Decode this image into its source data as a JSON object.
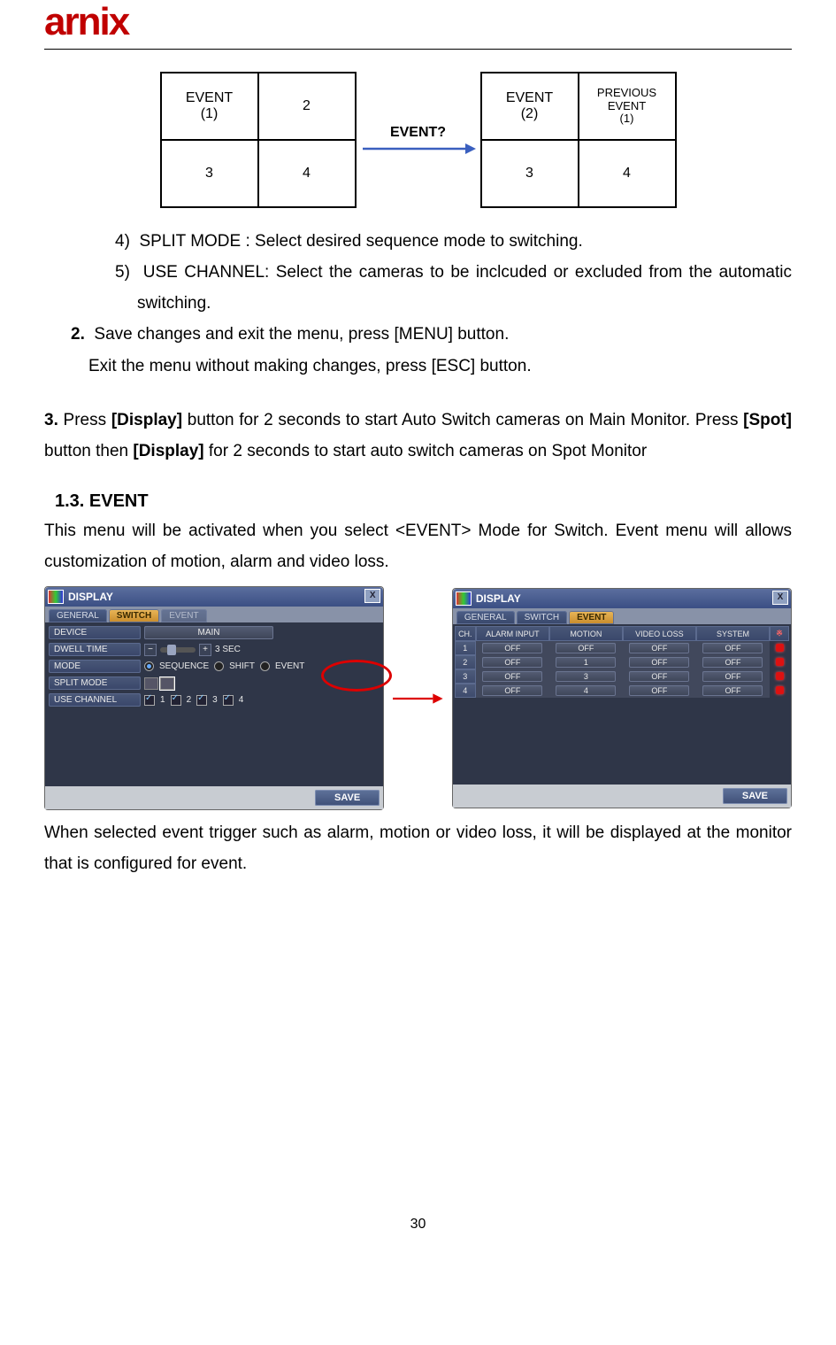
{
  "logo_text": "arnix",
  "diagram": {
    "left": [
      "EVENT\n(1)",
      "2",
      "3",
      "4"
    ],
    "right": [
      "EVENT\n(2)",
      "PREVIOUS\nEVENT\n(1)",
      "3",
      "4"
    ],
    "arrow_label": "EVENT?"
  },
  "list_items": {
    "i4_num": "4)",
    "i4": "SPLIT MODE : Select desired sequence mode to switching.",
    "i5_num": "5)",
    "i5": "USE CHANNEL: Select the cameras to be inclcuded or excluded from the automatic switching.",
    "s2_num": "2.",
    "s2a": "Save changes and exit the menu, press [MENU] button.",
    "s2b": "Exit the menu without making changes, press [ESC] button.",
    "s3": "3. Press [Display] button for 2 seconds to start Auto Switch cameras on Main Monitor. Press [Spot] button then [Display] for 2 seconds to start auto switch cameras on Spot Monitor"
  },
  "section_head": "1.3.  EVENT",
  "intro": "This menu will be activated when you select <EVENT> Mode for Switch. Event menu will allows customization of motion, alarm and video loss.",
  "outro": " When selected event trigger such as alarm, motion or video loss, it will be displayed at the monitor that is configured for event.",
  "ui": {
    "title": "DISPLAY",
    "tabs": [
      "GENERAL",
      "SWITCH",
      "EVENT"
    ],
    "switch_rows": {
      "device": "DEVICE",
      "device_val": "MAIN",
      "dwell": "DWELL TIME",
      "dwell_val": "3 SEC",
      "mode": "MODE",
      "mode_opts": [
        "SEQUENCE",
        "SHIFT",
        "EVENT"
      ],
      "split": "SPLIT MODE",
      "usech": "USE CHANNEL",
      "usech_items": [
        "1",
        "2",
        "3",
        "4"
      ]
    },
    "save": "SAVE",
    "event_headers": [
      "CH.",
      "ALARM INPUT",
      "MOTION",
      "VIDEO LOSS",
      "SYSTEM",
      "※"
    ],
    "event_rows": [
      {
        "ch": "1",
        "alarm": "OFF",
        "motion": "OFF",
        "vloss": "OFF",
        "sys": "OFF"
      },
      {
        "ch": "2",
        "alarm": "OFF",
        "motion": "1",
        "vloss": "OFF",
        "sys": "OFF"
      },
      {
        "ch": "3",
        "alarm": "OFF",
        "motion": "3",
        "vloss": "OFF",
        "sys": "OFF"
      },
      {
        "ch": "4",
        "alarm": "OFF",
        "motion": "4",
        "vloss": "OFF",
        "sys": "OFF"
      }
    ]
  },
  "page_number": "30"
}
